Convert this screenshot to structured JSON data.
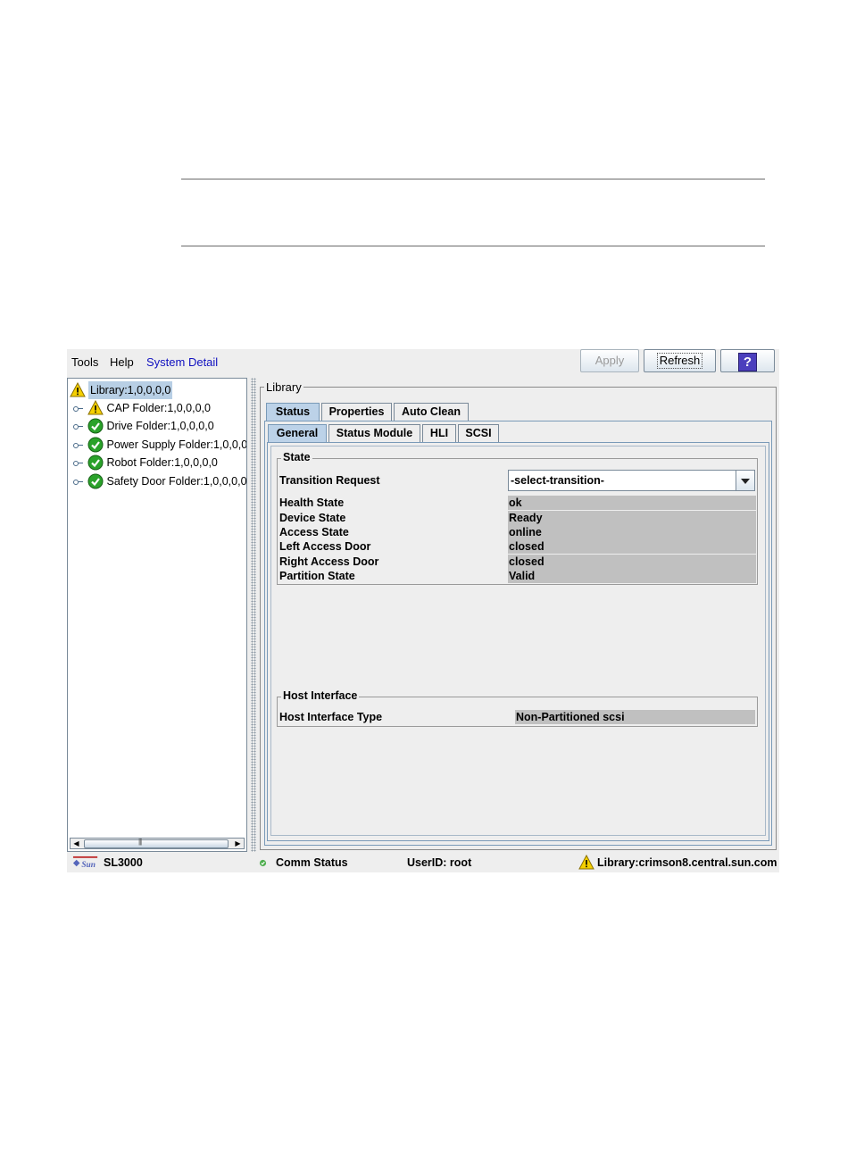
{
  "menubar": {
    "tools": "Tools",
    "help": "Help",
    "system_detail": "System Detail"
  },
  "toolbar": {
    "apply_label": "Apply",
    "refresh_label": "Refresh",
    "help_label": "?"
  },
  "tree": {
    "root": {
      "label": "Library:1,0,0,0,0",
      "status": "warning"
    },
    "items": [
      {
        "label": "CAP Folder:1,0,0,0,0",
        "status": "warning"
      },
      {
        "label": "Drive Folder:1,0,0,0,0",
        "status": "ok"
      },
      {
        "label": "Power Supply Folder:1,0,0,0,",
        "status": "ok"
      },
      {
        "label": "Robot Folder:1,0,0,0,0",
        "status": "ok"
      },
      {
        "label": "Safety Door Folder:1,0,0,0,0",
        "status": "ok"
      }
    ]
  },
  "panel": {
    "title": "Library",
    "tabs": [
      "Status",
      "Properties",
      "Auto Clean"
    ],
    "subtabs": [
      "General",
      "Status Module",
      "HLI",
      "SCSI"
    ],
    "state_group": {
      "title": "State",
      "transition_label": "Transition Request",
      "transition_value": "-select-transition-",
      "fields": [
        {
          "label": "Health State",
          "value": "ok"
        },
        {
          "label": "Device State",
          "value": "Ready"
        },
        {
          "label": "Access State",
          "value": "online"
        },
        {
          "label": "Left Access Door",
          "value": "closed"
        },
        {
          "label": "Right Access Door",
          "value": "closed"
        },
        {
          "label": "Partition State",
          "value": "Valid"
        }
      ]
    },
    "host_group": {
      "title": "Host Interface",
      "label": "Host Interface Type",
      "value": "Non-Partitioned scsi"
    }
  },
  "statusbar": {
    "product": "SL3000",
    "comm_status": "Comm Status",
    "user": "UserID: root",
    "library": "Library:crimson8.central.sun.com"
  },
  "colors": {
    "warning": "#f5d000",
    "ok": "#2aa22a",
    "selection": "#b8cfe5",
    "value_bg": "#c0c0c0"
  }
}
